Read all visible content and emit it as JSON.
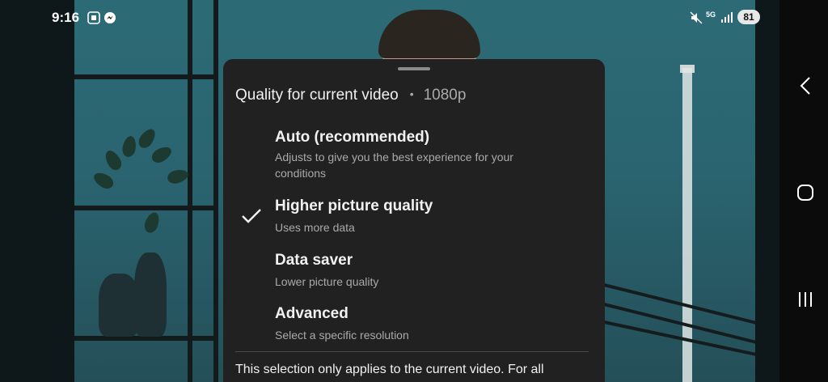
{
  "status_bar": {
    "time": "9:16",
    "battery": "81",
    "network": "5G"
  },
  "quality_sheet": {
    "header_title": "Quality for current video",
    "header_separator": "•",
    "current_resolution": "1080p",
    "options": [
      {
        "title": "Auto (recommended)",
        "description": "Adjusts to give you the best experience for your conditions",
        "selected": false
      },
      {
        "title": "Higher picture quality",
        "description": "Uses more data",
        "selected": true
      },
      {
        "title": "Data saver",
        "description": "Lower picture quality",
        "selected": false
      },
      {
        "title": "Advanced",
        "description": "Select a specific resolution",
        "selected": false
      }
    ],
    "footer_note": "This selection only applies to the current video. For all"
  },
  "icons": {
    "check": "check-icon",
    "back": "back-icon",
    "home": "home-icon",
    "recents": "recents-icon"
  },
  "colors": {
    "sheet_background": "#212121",
    "primary_text": "#f1f1f1",
    "secondary_text": "#aaaaaa"
  }
}
